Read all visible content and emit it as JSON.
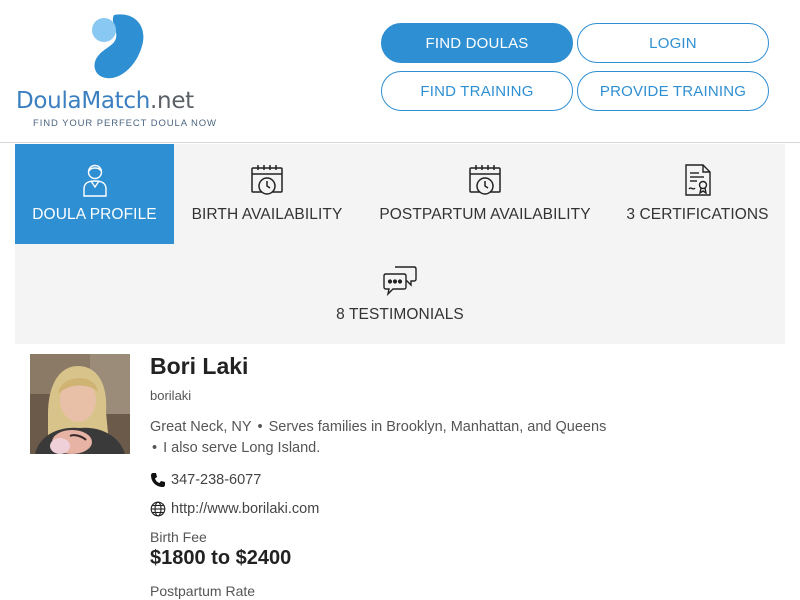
{
  "brand": {
    "name_blue": "DoulaMatch",
    "name_dark": ".net",
    "tagline": "FIND YOUR PERFECT DOULA NOW",
    "primary_color": "#2f8fd3"
  },
  "nav": {
    "find_doulas": "FIND DOULAS",
    "login": "LOGIN",
    "find_training": "FIND TRAINING",
    "provide_training": "PROVIDE TRAINING"
  },
  "tabs": [
    {
      "label": "DOULA PROFILE",
      "icon": "person-icon",
      "active": true
    },
    {
      "label": "BIRTH AVAILABILITY",
      "icon": "calendar-clock-icon"
    },
    {
      "label": "POSTPARTUM AVAILABILITY",
      "icon": "calendar-clock-icon"
    },
    {
      "label": "3 CERTIFICATIONS",
      "icon": "certificate-icon"
    },
    {
      "label": "8 TESTIMONIALS",
      "icon": "chat-bubbles-icon"
    }
  ],
  "profile": {
    "name": "Bori Laki",
    "username": "borilaki",
    "location": "Great Neck, NY",
    "serves": "Serves families in Brooklyn, Manhattan, and Queens",
    "extra_service": "I also serve Long Island.",
    "phone": "347-238-6077",
    "website": "http://www.borilaki.com",
    "birth_fee_label": "Birth Fee",
    "birth_fee": "$1800 to $2400",
    "postpartum_label": "Postpartum Rate"
  }
}
